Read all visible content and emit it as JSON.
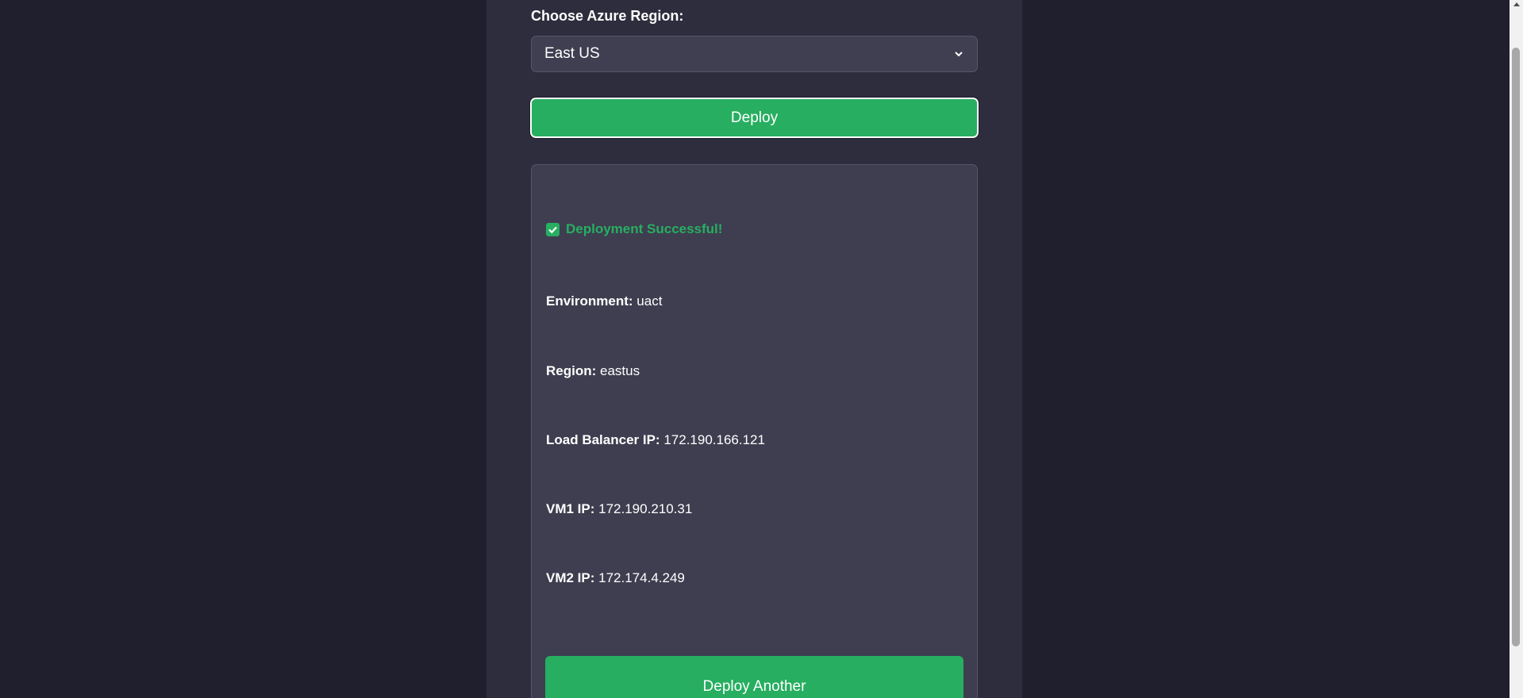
{
  "form": {
    "region_label": "Choose Azure Region:",
    "region_selected": "East US",
    "deploy_label": "Deploy"
  },
  "result": {
    "success_text": "Deployment Successful!",
    "details": [
      {
        "label": "Environment:",
        "value": "uact"
      },
      {
        "label": "Region:",
        "value": "eastus"
      },
      {
        "label": "Load Balancer IP:",
        "value": "172.190.166.121"
      },
      {
        "label": "VM1 IP:",
        "value": "172.190.210.31"
      },
      {
        "label": "VM2 IP:",
        "value": "172.174.4.249"
      }
    ],
    "deploy_another_label": "Deploy Another"
  },
  "colors": {
    "background": "#1f1f2e",
    "panel": "#2d2d3d",
    "accent_green": "#27ae60",
    "result_box": "#3e3e50"
  },
  "icons": {
    "success": "check-box-icon",
    "select": "chevron-down-icon"
  }
}
